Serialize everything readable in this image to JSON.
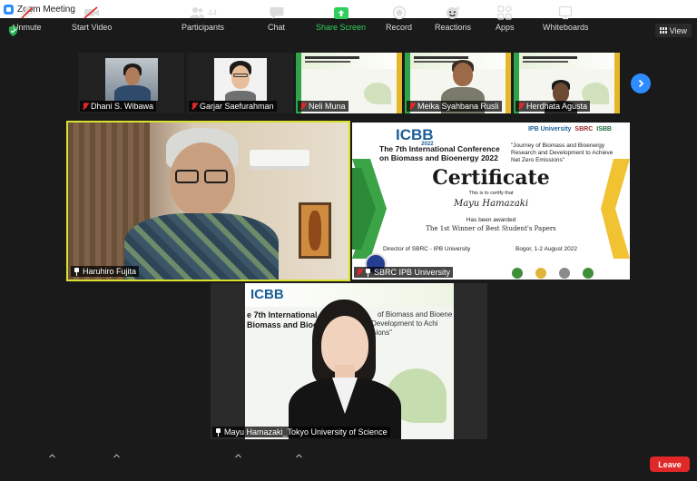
{
  "window": {
    "title": "Zoom Meeting"
  },
  "view_button": {
    "label": "View"
  },
  "thumbnails": [
    {
      "name": "Dhani S. Wibawa"
    },
    {
      "name": "Garjar Saefurahman"
    },
    {
      "name": "Neli Muna"
    },
    {
      "name": "Meika Syahbana Rusli"
    },
    {
      "name": "Herdhata Agusta"
    }
  ],
  "tiles": {
    "speaker": {
      "name": "Haruhiro Fujita"
    },
    "share": {
      "name": "SBRC IPB University"
    },
    "presenter": {
      "name": "Mayu Hamazaki_Tokyo University of Science"
    }
  },
  "certificate": {
    "logo": "ICBB",
    "logo_year": "2022",
    "conference_line1": "The 7th International Conference",
    "conference_line2": "on Biomass and Bioenergy 2022",
    "journey": "\"Journey of Biomass and Bioenergy Research and Development to Achieve Net Zero Emissions\"",
    "partner1": "IPB University",
    "partner2": "SBRC",
    "partner3": "ISBB",
    "title": "Certificate",
    "certify_text": "This is to certify that",
    "recipient": "Mayu Hamazaki",
    "awarded_text": "Has been awarded",
    "award": "The 1st Winner of Best Student's Papers",
    "signer": "Director of SBRC - IPB University",
    "place_date": "Bogor, 1-2 August 2022"
  },
  "presenter_slide": {
    "logo": "ICBB",
    "title1": "e 7th International Conf",
    "title2": "Biomass and Bioener",
    "journey1": "of Biomass and Bioene",
    "journey2": "ed Development to Achi",
    "journey3": "missions\""
  },
  "toolbar": {
    "unmute": "Unmute",
    "start_video": "Start Video",
    "participants": "Participants",
    "participant_count": "44",
    "chat": "Chat",
    "share_screen": "Share Screen",
    "record": "Record",
    "reactions": "Reactions",
    "apps": "Apps",
    "whiteboards": "Whiteboards",
    "leave": "Leave"
  },
  "colors": {
    "zoom_blue": "#2d8cff",
    "active_speaker_border": "#d9e02f",
    "share_green": "#2fcf5c",
    "leave_red": "#e02828",
    "muted_red": "#e02828"
  }
}
